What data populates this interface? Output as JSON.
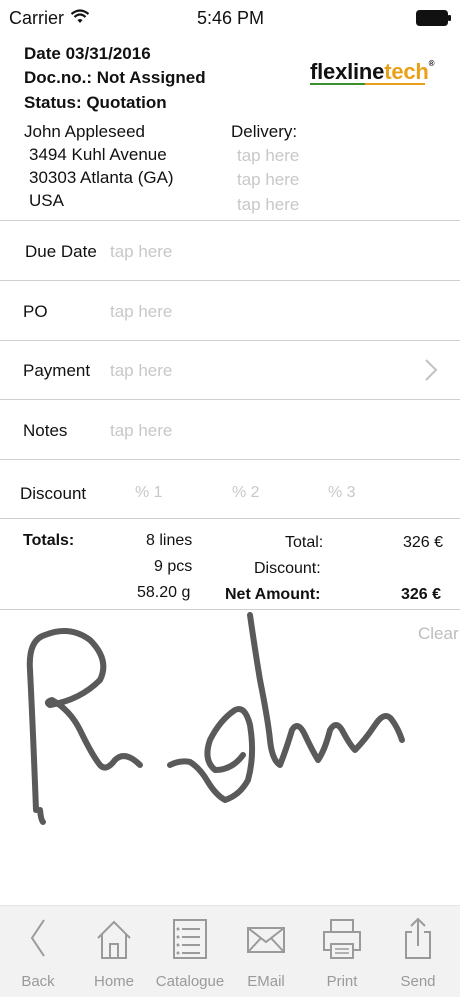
{
  "status_bar": {
    "carrier": "Carrier",
    "time": "5:46 PM"
  },
  "header": {
    "date_line": "Date 03/31/2016",
    "doc_line": "Doc.no.: Not Assigned",
    "status_line": "Status: Quotation",
    "logo": {
      "part1": "flexline",
      "part2": "tech",
      "mark": "®"
    }
  },
  "customer": {
    "name": "John Appleseed",
    "street": "3494 Kuhl Avenue",
    "city": "30303 Atlanta (GA)",
    "country": "USA"
  },
  "delivery": {
    "label": "Delivery:",
    "lines": [
      "tap here",
      "tap here",
      "tap here"
    ]
  },
  "fields": {
    "due_date": {
      "label": "Due Date",
      "placeholder": "tap here"
    },
    "po": {
      "label": "PO",
      "placeholder": "tap here"
    },
    "payment": {
      "label": "Payment",
      "placeholder": "tap here"
    },
    "notes": {
      "label": "Notes",
      "placeholder": "tap here"
    }
  },
  "discount": {
    "label": "Discount",
    "p1": "% 1",
    "p2": "% 2",
    "p3": "% 3"
  },
  "totals": {
    "label": "Totals:",
    "lines": "8 lines",
    "pcs": "9 pcs",
    "weight": "58.20 g",
    "total_label": "Total:",
    "total_value": "326 €",
    "discount_label": "Discount:",
    "net_label": "Net Amount:",
    "net_value": "326 €"
  },
  "signature": {
    "clear": "Clear"
  },
  "tabbar": {
    "back": "Back",
    "home": "Home",
    "catalogue": "Catalogue",
    "email": "EMail",
    "print": "Print",
    "send": "Send"
  },
  "colors": {
    "placeholder": "#c8c8c8",
    "tab_icon": "#9a9a9a",
    "logo_accent": "#e8a01a",
    "logo_green": "#3a8f2e",
    "signature": "#5a5a5a"
  }
}
